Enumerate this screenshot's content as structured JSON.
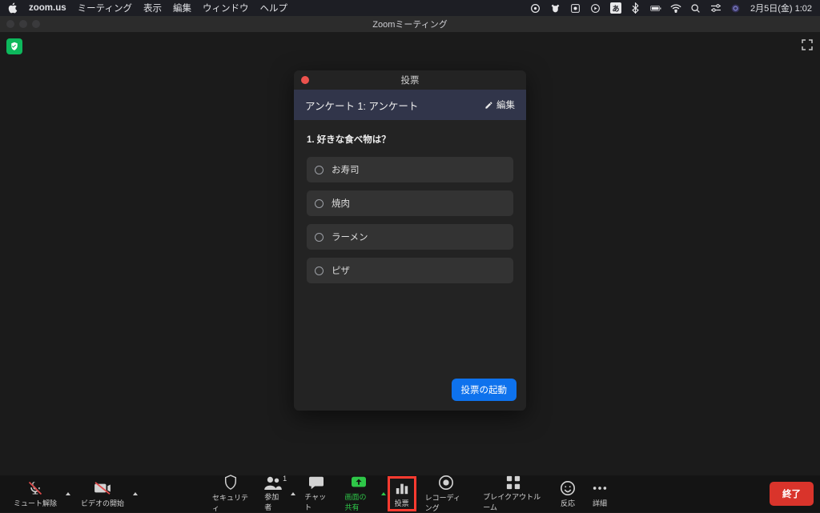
{
  "menubar": {
    "app": "zoom.us",
    "items": [
      "ミーティング",
      "表示",
      "編集",
      "ウィンドウ",
      "ヘルプ"
    ],
    "clock": "2月5日(金) 1:02"
  },
  "window": {
    "title": "Zoomミーティング"
  },
  "poll": {
    "panel_title": "投票",
    "header_title": "アンケート 1: アンケート",
    "edit_label": "編集",
    "question": "1. 好きな食べ物は？",
    "options": [
      "お寿司",
      "焼肉",
      "ラーメン",
      "ピザ"
    ],
    "launch_label": "投票の起動"
  },
  "toolbar": {
    "unmute": "ミュート解除",
    "start_video": "ビデオの開始",
    "security": "セキュリティ",
    "participants": "参加者",
    "participants_count": "1",
    "chat": "チャット",
    "share": "画面の共有",
    "poll": "投票",
    "recording": "レコーディング",
    "breakout": "ブレイクアウトルーム",
    "reactions": "反応",
    "more": "詳細",
    "end": "終了"
  }
}
